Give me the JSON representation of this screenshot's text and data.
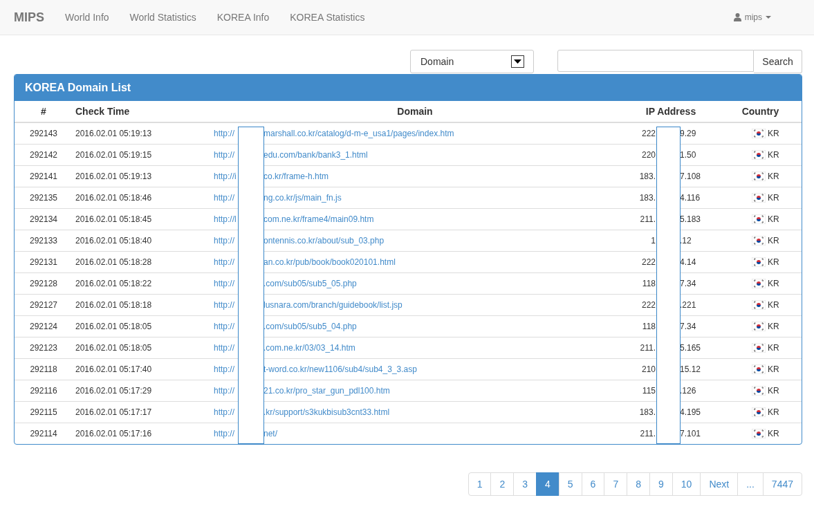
{
  "navbar": {
    "brand": "MIPS",
    "links": [
      "World Info",
      "World Statistics",
      "KOREA Info",
      "KOREA Statistics"
    ],
    "user": "mips"
  },
  "search": {
    "filter": "Domain",
    "button": "Search"
  },
  "panel": {
    "title": "KOREA Domain List"
  },
  "table": {
    "columns": [
      "#",
      "Check Time",
      "Domain",
      "IP Address",
      "Country"
    ],
    "rows": [
      {
        "id": "292143",
        "time": "2016.02.01 05:19:13",
        "domain_start": "http://",
        "domain_end": "marshall.co.kr/catalog/d-m-e_usa1/pages/index.htm",
        "ip_start": "222",
        "ip_end": "9.29",
        "country": "KR"
      },
      {
        "id": "292142",
        "time": "2016.02.01 05:19:15",
        "domain_start": "http://",
        "domain_end": "edu.com/bank/bank3_1.html",
        "ip_start": "220",
        "ip_end": "1.50",
        "country": "KR"
      },
      {
        "id": "292141",
        "time": "2016.02.01 05:19:13",
        "domain_start": "http://i",
        "domain_end": "co.kr/frame-h.htm",
        "ip_start": "183.",
        "ip_end": "7.108",
        "country": "KR"
      },
      {
        "id": "292135",
        "time": "2016.02.01 05:18:46",
        "domain_start": "http://",
        "domain_end": "ng.co.kr/js/main_fn.js",
        "ip_start": "183.",
        "ip_end": "4.116",
        "country": "KR"
      },
      {
        "id": "292134",
        "time": "2016.02.01 05:18:45",
        "domain_start": "http://l",
        "domain_end": "com.ne.kr/frame4/main09.htm",
        "ip_start": "211.",
        "ip_end": "5.183",
        "country": "KR"
      },
      {
        "id": "292133",
        "time": "2016.02.01 05:18:40",
        "domain_start": "http://",
        "domain_end": "ontennis.co.kr/about/sub_03.php",
        "ip_start": "1",
        "ip_end": ".12",
        "country": "KR"
      },
      {
        "id": "292131",
        "time": "2016.02.01 05:18:28",
        "domain_start": "http://",
        "domain_end": "an.co.kr/pub/book/book020101.html",
        "ip_start": "222",
        "ip_end": "4.14",
        "country": "KR"
      },
      {
        "id": "292128",
        "time": "2016.02.01 05:18:22",
        "domain_start": "http://",
        "domain_end": ".com/sub05/sub5_05.php",
        "ip_start": "118",
        "ip_end": "7.34",
        "country": "KR"
      },
      {
        "id": "292127",
        "time": "2016.02.01 05:18:18",
        "domain_start": "http://",
        "domain_end": "lusnara.com/branch/guidebook/list.jsp",
        "ip_start": "222",
        "ip_end": ".221",
        "country": "KR"
      },
      {
        "id": "292124",
        "time": "2016.02.01 05:18:05",
        "domain_start": "http://",
        "domain_end": ".com/sub05/sub5_04.php",
        "ip_start": "118",
        "ip_end": "7.34",
        "country": "KR"
      },
      {
        "id": "292123",
        "time": "2016.02.01 05:18:05",
        "domain_start": "http://",
        "domain_end": ".com.ne.kr/03/03_14.htm",
        "ip_start": "211.",
        "ip_end": "5.165",
        "country": "KR"
      },
      {
        "id": "292118",
        "time": "2016.02.01 05:17:40",
        "domain_start": "http://",
        "domain_end": "t-word.co.kr/new1106/sub4/sub4_3_3.asp",
        "ip_start": "210",
        "ip_end": "15.12",
        "country": "KR"
      },
      {
        "id": "292116",
        "time": "2016.02.01 05:17:29",
        "domain_start": "http://",
        "domain_end": "21.co.kr/pro_star_gun_pdl100.htm",
        "ip_start": "115",
        "ip_end": ".126",
        "country": "KR"
      },
      {
        "id": "292115",
        "time": "2016.02.01 05:17:17",
        "domain_start": "http://",
        "domain_end": ".kr/support/s3kukbisub3cnt33.html",
        "ip_start": "183.",
        "ip_end": "4.195",
        "country": "KR"
      },
      {
        "id": "292114",
        "time": "2016.02.01 05:17:16",
        "domain_start": "http://",
        "domain_end": "net/",
        "ip_start": "211.",
        "ip_end": "7.101",
        "country": "KR"
      }
    ]
  },
  "pagination": [
    {
      "label": "1",
      "selected": false
    },
    {
      "label": "2",
      "selected": false
    },
    {
      "label": "3",
      "selected": false
    },
    {
      "label": "4",
      "selected": true
    },
    {
      "label": "5",
      "selected": false
    },
    {
      "label": "6",
      "selected": false
    },
    {
      "label": "7",
      "selected": false
    },
    {
      "label": "8",
      "selected": false
    },
    {
      "label": "9",
      "selected": false
    },
    {
      "label": "10",
      "selected": false
    },
    {
      "label": "Next",
      "selected": false
    },
    {
      "label": "...",
      "selected": false
    },
    {
      "label": "7447",
      "selected": false
    }
  ]
}
